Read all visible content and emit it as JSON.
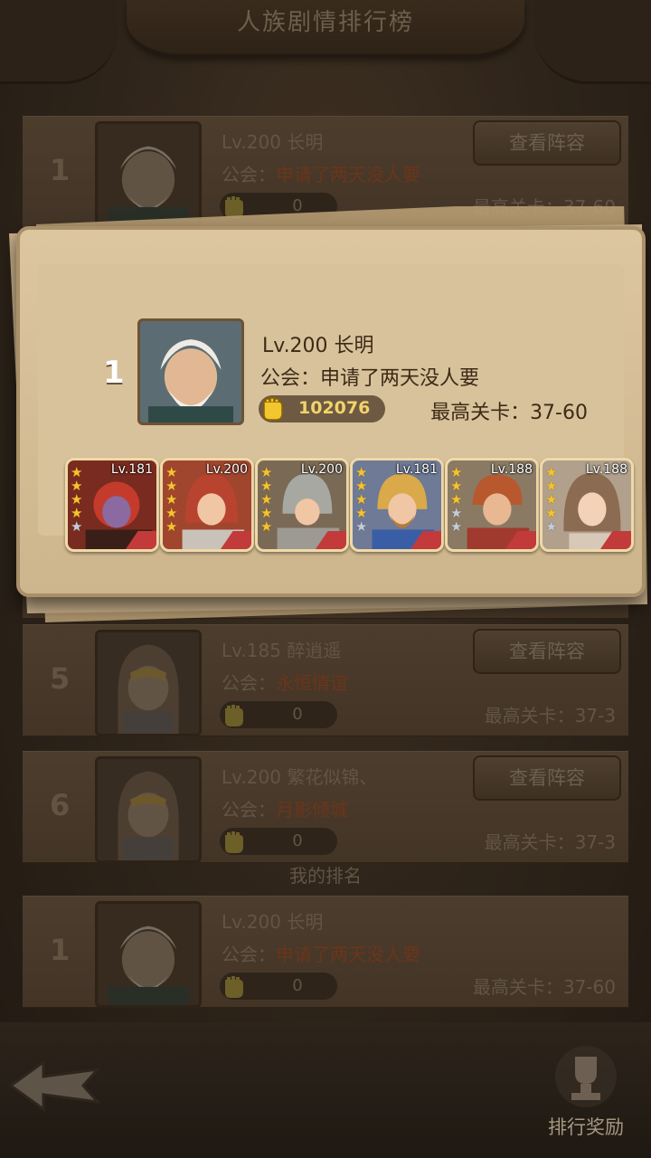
{
  "header": {
    "title": "人族剧情排行榜"
  },
  "labels": {
    "view_lineup": "查看阵容",
    "guild_prefix": "公会：",
    "stage_prefix": "最高关卡：",
    "my_rank": "我的排名",
    "rank_reward": "排行奖励"
  },
  "rows": [
    {
      "rank": "1",
      "name": "Lv.200 长明",
      "guild": "申请了两天没人要",
      "power": "0",
      "stage": "最高关卡：37-60"
    },
    {
      "rank": "5",
      "name": "Lv.185 醉逍遥",
      "guild": "永恒情谊",
      "power": "0",
      "stage": "最高关卡：37-3"
    },
    {
      "rank": "6",
      "name": "Lv.200 繁花似锦、",
      "guild": "月影倾城",
      "power": "0",
      "stage": "最高关卡：37-3"
    }
  ],
  "my_row": {
    "rank": "1",
    "name": "Lv.200 长明",
    "guild": "申请了两天没人要",
    "power": "0",
    "stage": "最高关卡：37-60"
  },
  "popup": {
    "rank": "1",
    "name": "Lv.200 长明",
    "guild": "公会：申请了两天没人要",
    "power": "102076",
    "stage": "最高关卡：37-60",
    "heroes": [
      {
        "level": "Lv.181",
        "stars": 5,
        "color": "#c43b2b"
      },
      {
        "level": "Lv.200",
        "stars": 5,
        "color": "#b8432e"
      },
      {
        "level": "Lv.200",
        "stars": 5,
        "color": "#8a8a84"
      },
      {
        "level": "Lv.181",
        "stars": 5,
        "color": "#3a5ea6"
      },
      {
        "level": "Lv.188",
        "stars": 5,
        "color": "#8a6a3c"
      },
      {
        "level": "Lv.188",
        "stars": 5,
        "color": "#8b6b52"
      }
    ]
  }
}
